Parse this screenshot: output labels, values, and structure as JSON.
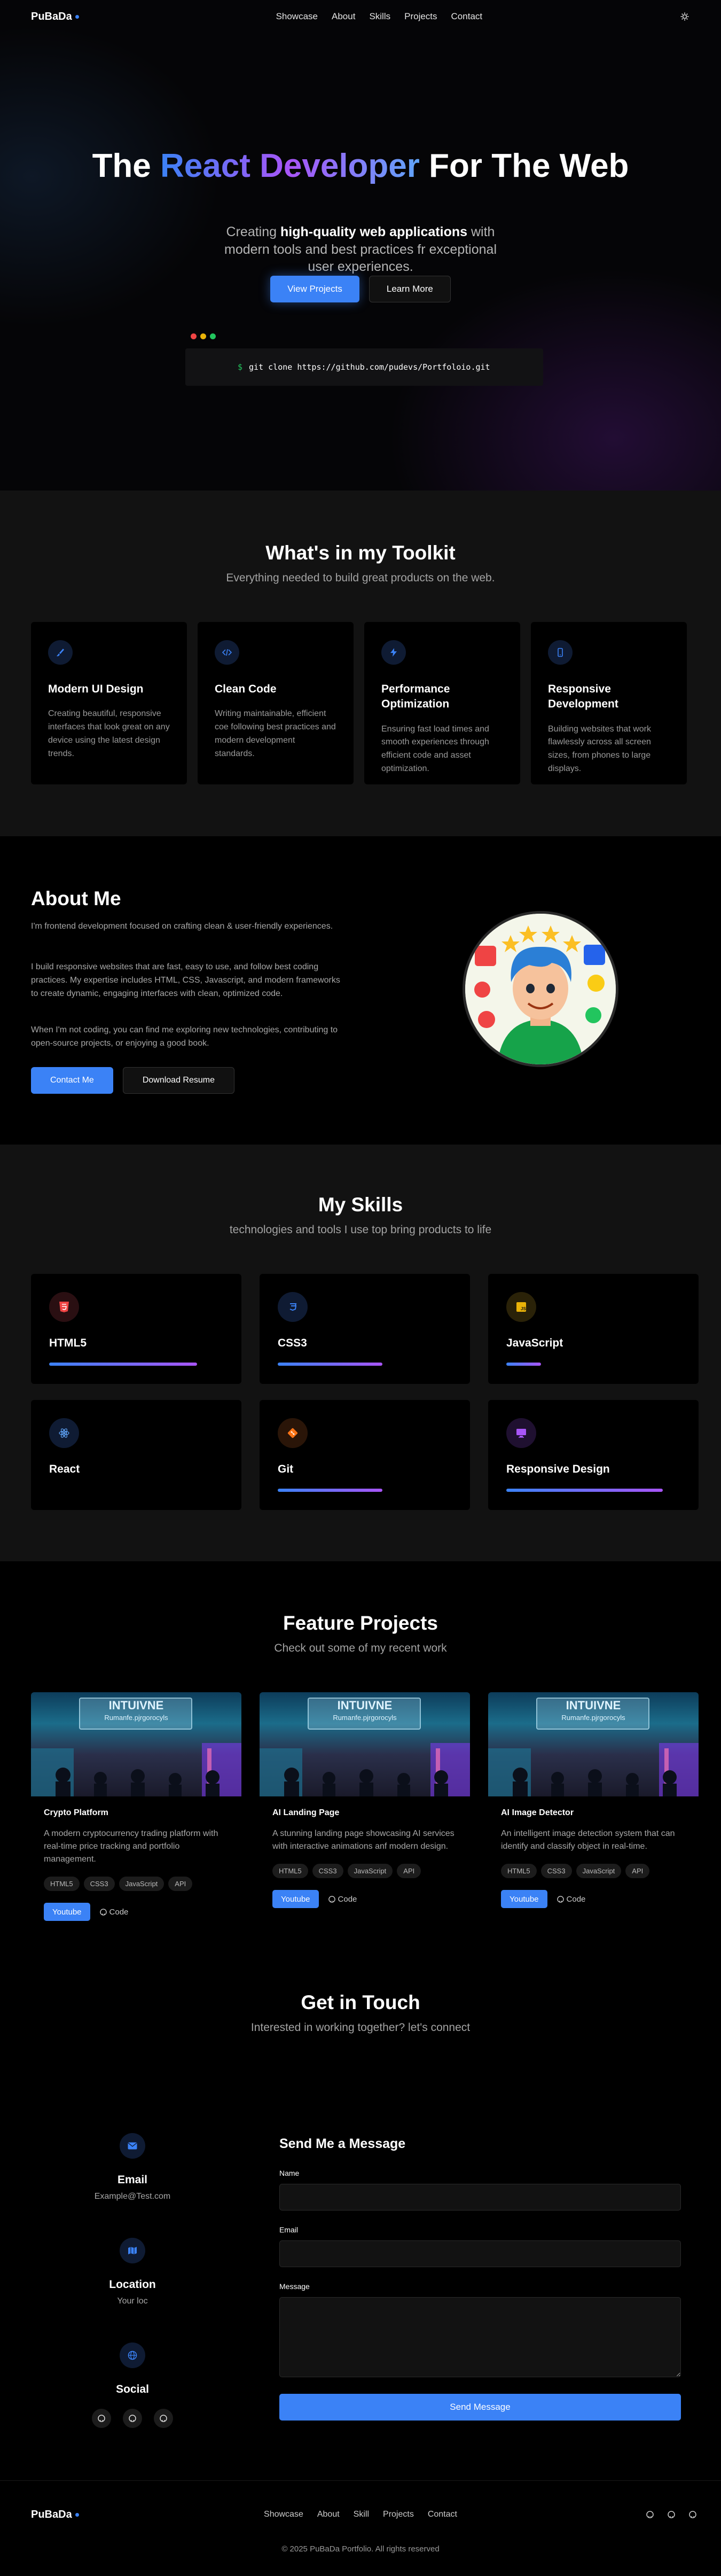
{
  "header": {
    "logo": "PuBaDa",
    "nav": [
      "Showcase",
      "About",
      "Skills",
      "Projects",
      "Contact"
    ]
  },
  "hero": {
    "title_parts": [
      "The ",
      "React Developer",
      " For The Web"
    ],
    "subtitle_pre": "Creating ",
    "subtitle_bold": "high-quality web applications",
    "subtitle_post": " with modern tools and best practices fr exceptional user experiences.",
    "btn_primary": "View Projects",
    "btn_secondary": "Learn More",
    "terminal_prompt": "$",
    "terminal_command": "git clone https://github.com/pudevs/Portfoloio.git"
  },
  "toolkit": {
    "title": "What's in my Toolkit",
    "subtitle": "Everything needed to build great products on the web.",
    "cards": [
      {
        "icon": "brush-icon",
        "title": "Modern UI Design",
        "text": "Creating beautiful, responsive interfaces that look great on any device using the latest design trends."
      },
      {
        "icon": "code-icon",
        "title": "Clean Code",
        "text": "Writing maintainable, efficient coe following best practices and modern development standards."
      },
      {
        "icon": "lightning-icon",
        "title": "Performance Optimization",
        "text": "Ensuring fast load times and smooth experiences through efficient code and asset optimization."
      },
      {
        "icon": "mobile-icon",
        "title": "Responsive Development",
        "text": "Building websites that work flawlessly across all screen sizes, from phones to large displays."
      }
    ]
  },
  "about": {
    "title": "About Me",
    "p1": "I'm frontend development focused on crafting clean & user-friendly experiences.",
    "p2": "I build responsive websites that are fast, easy to use, and follow best coding practices. My expertise includes HTML, CSS, Javascript, and modern frameworks to create dynamic, engaging interfaces with clean, optimized code.",
    "p3": "When I'm not coding, you can find me exploring new technologies, contributing to open-source projects, or enjoying a good book.",
    "btn_contact": "Contact Me",
    "btn_resume": "Download Resume"
  },
  "skills": {
    "title": "My Skills",
    "subtitle": "technologies and tools I use top bring products to life",
    "items": [
      {
        "name": "HTML5",
        "level": 0.85,
        "icon": "html5-icon",
        "color": "#ef4444"
      },
      {
        "name": "CSS3",
        "level": 0.6,
        "icon": "css3-icon",
        "color": "#3b82f6"
      },
      {
        "name": "JavaScript",
        "level": 0.2,
        "icon": "javascript-icon",
        "color": "#eab308"
      },
      {
        "name": "React",
        "level": 0,
        "icon": "react-icon",
        "color": "#60a5fa"
      },
      {
        "name": "Git",
        "level": 0.6,
        "icon": "git-icon",
        "color": "#f97316"
      },
      {
        "name": "Responsive Design",
        "level": 0.9,
        "icon": "monitor-icon",
        "color": "#a855f7"
      }
    ]
  },
  "projects": {
    "title": "Feature Projects",
    "subtitle": "Check out some of my recent work",
    "image_title": "INTUIVNE",
    "image_sub": "Rumanfe.pjrgorocyls",
    "items": [
      {
        "title": "Crypto Platform",
        "text": "A modern cryptocurrency trading platform with real-time price tracking and portfolio management.",
        "tags": [
          "HTML5",
          "CSS3",
          "JavaScript",
          "API"
        ],
        "link1": "Youtube",
        "link2": "Code"
      },
      {
        "title": "AI Landing Page",
        "text": "A stunning landing page showcasing AI services with interactive animations anf modern design.",
        "tags": [
          "HTML5",
          "CSS3",
          "JavaScript",
          "API"
        ],
        "link1": "Youtube",
        "link2": "Code"
      },
      {
        "title": "AI Image Detector",
        "text": "An intelligent image detection system that can identify and classify object in real-time.",
        "tags": [
          "HTML5",
          "CSS3",
          "JavaScript",
          "API"
        ],
        "link1": "Youtube",
        "link2": "Code"
      }
    ]
  },
  "contact": {
    "title": "Get in Touch",
    "subtitle": "Interested in working together? let's connect",
    "email_label": "Email",
    "email_value": "Example@Test.com",
    "location_label": "Location",
    "location_value": "Your loc",
    "social_label": "Social",
    "form_title": "Send Me a Message",
    "name_label": "Name",
    "email_field_label": "Email",
    "message_label": "Message",
    "send_label": "Send Message"
  },
  "footer": {
    "logo": "PuBaDa",
    "nav": [
      "Showcase",
      "About",
      "Skill",
      "Projects",
      "Contact"
    ],
    "copyright": "© 2025 PuBaDa Portfolio. All rights reserved"
  },
  "colors": {
    "accent": "#3b82f6",
    "purple": "#a855f7"
  }
}
